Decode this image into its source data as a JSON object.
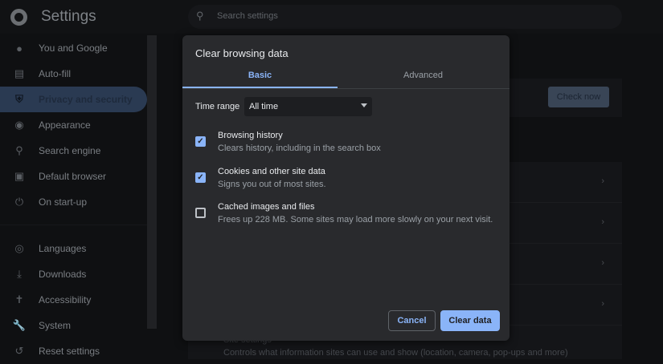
{
  "header": {
    "title": "Settings",
    "search_placeholder": "Search settings"
  },
  "sidebar": {
    "items": [
      {
        "label": "You and Google",
        "icon": "person-icon"
      },
      {
        "label": "Auto-fill",
        "icon": "clipboard-icon"
      },
      {
        "label": "Privacy and security",
        "icon": "shield-icon",
        "active": true
      },
      {
        "label": "Appearance",
        "icon": "palette-icon"
      },
      {
        "label": "Search engine",
        "icon": "search-icon"
      },
      {
        "label": "Default browser",
        "icon": "browser-icon"
      },
      {
        "label": "On start-up",
        "icon": "power-icon"
      },
      {
        "label": "Languages",
        "icon": "globe-icon"
      },
      {
        "label": "Downloads",
        "icon": "download-icon"
      },
      {
        "label": "Accessibility",
        "icon": "accessibility-icon"
      },
      {
        "label": "System",
        "icon": "wrench-icon"
      },
      {
        "label": "Reset settings",
        "icon": "history-icon"
      }
    ]
  },
  "background": {
    "check_now": "Check now",
    "site_settings_title": "Site settings",
    "site_settings_desc": "Controls what information sites can use and show (location, camera, pop-ups and more)"
  },
  "dialog": {
    "title": "Clear browsing data",
    "tabs": [
      "Basic",
      "Advanced"
    ],
    "time_range_label": "Time range",
    "time_range_value": "All time",
    "options": [
      {
        "title": "Browsing history",
        "desc": "Clears history, including in the search box",
        "checked": true
      },
      {
        "title": "Cookies and other site data",
        "desc": "Signs you out of most sites.",
        "checked": true
      },
      {
        "title": "Cached images and files",
        "desc": "Frees up 228 MB. Some sites may load more slowly on your next visit.",
        "checked": false
      }
    ],
    "cancel": "Cancel",
    "clear": "Clear data"
  }
}
